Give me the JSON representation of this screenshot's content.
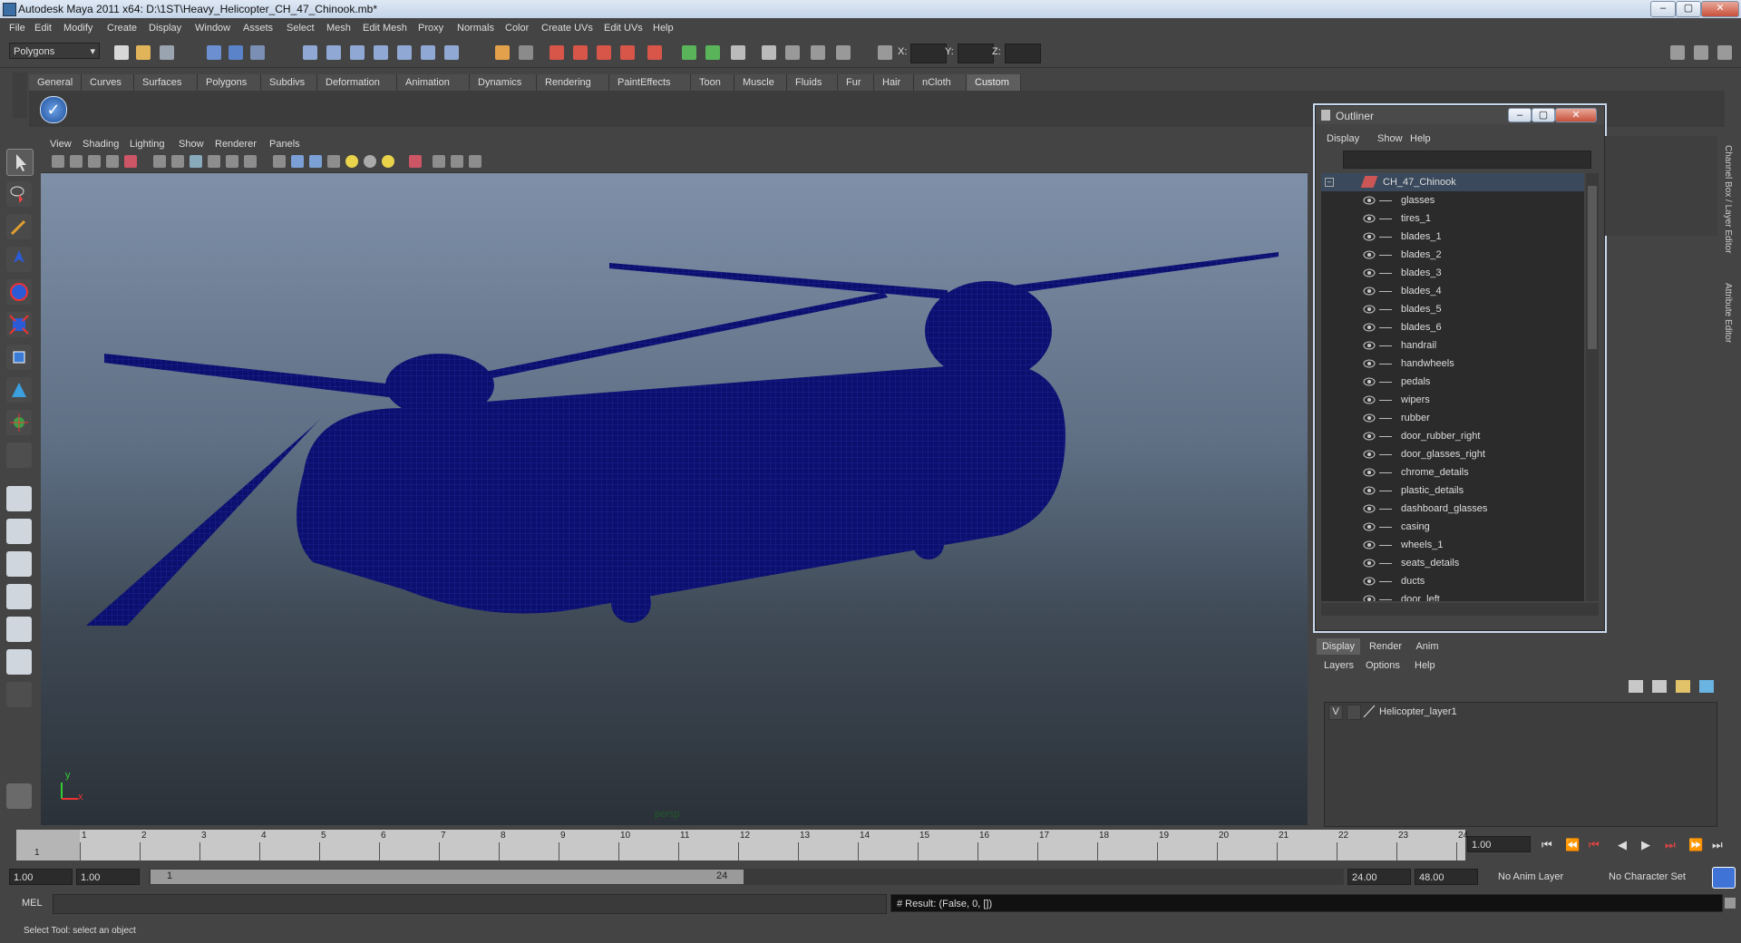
{
  "window": {
    "title": "Autodesk Maya 2011 x64: D:\\1ST\\Heavy_Helicopter_CH_47_Chinook.mb*"
  },
  "menubar": [
    "File",
    "Edit",
    "Modify",
    "Create",
    "Display",
    "Window",
    "Assets",
    "Select",
    "Mesh",
    "Edit Mesh",
    "Proxy",
    "Normals",
    "Color",
    "Create UVs",
    "Edit UVs",
    "Help"
  ],
  "toolbar": {
    "mode": "Polygons",
    "x_label": "X:",
    "y_label": "Y:",
    "z_label": "Z:"
  },
  "shelf_tabs": [
    "General",
    "Curves",
    "Surfaces",
    "Polygons",
    "Subdivs",
    "Deformation",
    "Animation",
    "Dynamics",
    "Rendering",
    "PaintEffects",
    "Toon",
    "Muscle",
    "Fluids",
    "Fur",
    "Hair",
    "nCloth",
    "Custom"
  ],
  "shelf_active": "Custom",
  "viewport": {
    "menu": [
      "View",
      "Shading",
      "Lighting",
      "Show",
      "Renderer",
      "Panels"
    ],
    "camera": "persp",
    "axis_y": "y",
    "axis_x": "x"
  },
  "outliner": {
    "title": "Outliner",
    "menu": [
      "Display",
      "Show",
      "Help"
    ],
    "root": "CH_47_Chinook",
    "items": [
      "glasses",
      "tires_1",
      "blades_1",
      "blades_2",
      "blades_3",
      "blades_4",
      "blades_5",
      "blades_6",
      "handrail",
      "handwheels",
      "pedals",
      "wipers",
      "rubber",
      "door_rubber_right",
      "door_glasses_right",
      "chrome_details",
      "plastic_details",
      "dashboard_glasses",
      "casing",
      "wheels_1",
      "seats_details",
      "ducts",
      "door_left"
    ]
  },
  "layer_editor": {
    "tabs": [
      "Display",
      "Render",
      "Anim"
    ],
    "active_tab": "Display",
    "menu": [
      "Layers",
      "Options",
      "Help"
    ],
    "layer_visibility": "V",
    "layer_name": "Helicopter_layer1"
  },
  "side_tabs": {
    "channel_box": "Channel Box / Layer Editor",
    "attribute_editor": "Attribute Editor"
  },
  "timeline": {
    "ticks": [
      "1",
      "2",
      "3",
      "4",
      "5",
      "6",
      "7",
      "8",
      "9",
      "10",
      "11",
      "12",
      "13",
      "14",
      "15",
      "16",
      "17",
      "18",
      "19",
      "20",
      "21",
      "22",
      "23",
      "24"
    ],
    "current_frame_marker": "1",
    "current_frame_field": "1.00"
  },
  "range": {
    "start": "1.00",
    "playback_start": "1.00",
    "slider_start": "1",
    "slider_end": "24",
    "playback_end": "24.00",
    "end": "48.00",
    "anim_layer": "No Anim Layer",
    "character_set": "No Character Set"
  },
  "command": {
    "lang": "MEL",
    "result": "# Result: (False, 0, [])"
  },
  "help_line": "Select Tool: select an object",
  "colors": {
    "wireframe": "#0b0f6e",
    "accent": "#5e5e5e"
  }
}
